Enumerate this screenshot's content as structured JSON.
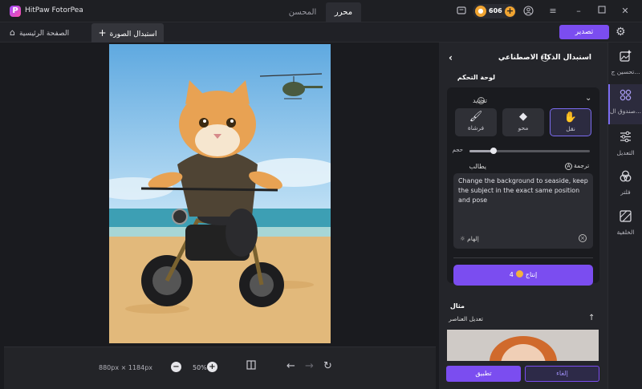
{
  "titlebar": {
    "app_name": "HitPaw FotorPea",
    "tabs": [
      "محرر",
      "المحسن"
    ],
    "credits": "606",
    "icons": [
      "chat-icon",
      "coin-icon",
      "plus-icon",
      "user-icon",
      "menu-icon",
      "minimize-icon",
      "maximize-icon",
      "close-icon"
    ]
  },
  "subbar": {
    "home_label": "الصفحة الرئيسية",
    "active_tab": "استبدال الصورة",
    "export_label": "تصدير"
  },
  "canvas": {
    "dimensions": "880px × 1184px",
    "zoom": "50%"
  },
  "panel": {
    "title": "استبدال الذكاء الاصطناعي",
    "dashboard_label": "لوحة التحكم",
    "selection_label": "تحديد",
    "tools": [
      {
        "label": "نقل",
        "icon": "hand-icon"
      },
      {
        "label": "محو",
        "icon": "eraser-icon"
      },
      {
        "label": "فرشاة",
        "icon": "brush-icon"
      }
    ],
    "size_label": "حجم",
    "size_value": 0.2,
    "prompt_label": "يطالب",
    "translate_label": "ترجمة",
    "prompt_text": "Change the background to seaside, keep the subject in the exact same position and pose",
    "inspire_label": "إلهام",
    "generate_label": "إنتاج",
    "generate_cost": "4",
    "examples_label": "مثال",
    "edit_elements_label": "تعديل العناصر",
    "apply_label": "تطبيق",
    "cancel_label": "إلغاء"
  },
  "rail": {
    "items": [
      {
        "label": "تحسين ج...",
        "icon": "sparkle-image-icon"
      },
      {
        "label": "صندوق ال...",
        "icon": "toolbox-icon"
      },
      {
        "label": "التعديل",
        "icon": "sliders-icon"
      },
      {
        "label": "فلتر",
        "icon": "filter-icon"
      },
      {
        "label": "الخلفية",
        "icon": "background-icon"
      }
    ]
  },
  "colors": {
    "accent": "#7b4df0",
    "background": "#1a1b1f",
    "panel": "#24252a"
  }
}
